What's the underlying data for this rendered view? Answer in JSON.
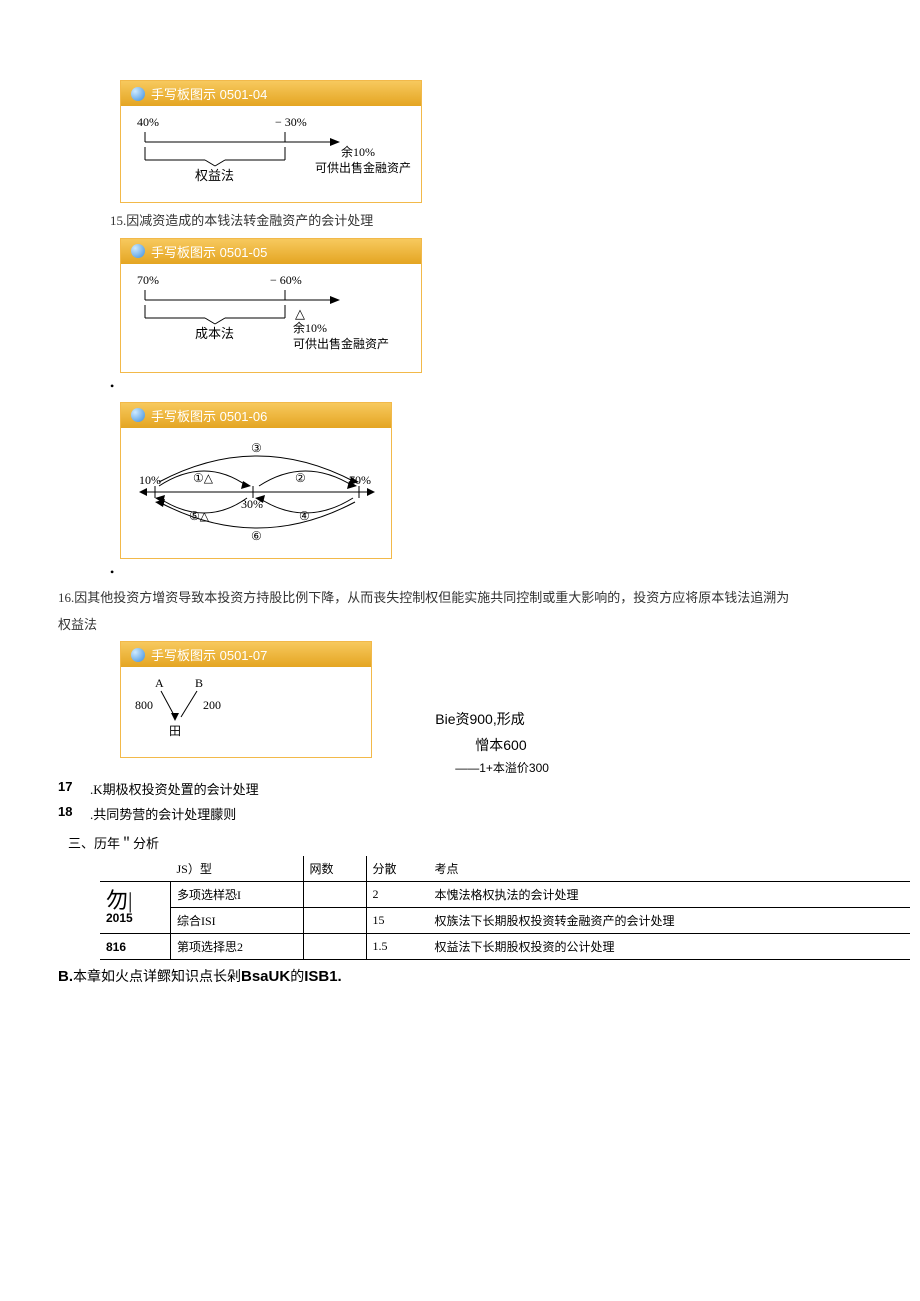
{
  "diagrams": {
    "d04": {
      "header": "手写板图示  0501-04",
      "left": "40%",
      "right": "− 30%",
      "method": "权益法",
      "rest": "余10%",
      "asset": "可供出售金融资产"
    },
    "d05": {
      "header": "手写板图示  0501-05",
      "left": "70%",
      "right": "− 60%",
      "method": "成本法",
      "rest": "余10%",
      "asset": "可供出售金融资产"
    },
    "d06": {
      "header": "手写板图示  0501-06",
      "p10": "10%",
      "p30": "30%",
      "p70": "70%",
      "c1": "①△",
      "c2": "②",
      "c3": "③",
      "c4": "④",
      "c5": "⑤△",
      "c6": "⑥"
    },
    "d07": {
      "header": "手写板图示  0501-07",
      "a": "A",
      "b": "B",
      "v800": "800",
      "v200": "200",
      "tian": "田",
      "line1": "Bie资900,形成",
      "line2": "憎本600",
      "line3": "——1+本溢价300"
    }
  },
  "paras": {
    "p15": "15.因减资造成的本钱法转金融资产的会计处理",
    "p16": "16.因其他投资方增资导致本投资方持股比例下降，从而丧失控制权但能实施共同控制或重大影响的，投资方应将原本钱法追溯为",
    "p16b": "权益法",
    "p17_n": "17",
    "p17_t": ".K期极权投资处置的会计处理",
    "p18_n": "18",
    "p18_t": ".共同势营的会计处理朦则",
    "sec3": "三、历年＂分析",
    "footer_pre": "B.",
    "footer_mid": "本章如火点详鳏知识点长剁",
    "footer_b1": "BsaUK",
    "footer_mid2": "的",
    "footer_b2": "ISB1."
  },
  "table": {
    "headers": {
      "type": "JS）型",
      "count": "网数",
      "score": "分散",
      "topic": "考点"
    },
    "left": {
      "year_glyph": "勿|",
      "year": "2015",
      "y2": "816"
    },
    "rows": [
      {
        "type": "多项选样恐I",
        "count": "",
        "score": "2",
        "topic": "本愧法格权执法的会计处理"
      },
      {
        "type": "综合ISI",
        "count": "",
        "score": "15",
        "topic": "权族法下长期股权投资转金融资产的会计处理"
      },
      {
        "type": "第项选择思2",
        "count": "",
        "score": "1.5",
        "topic": "权益法下长期股权投资的公计处理"
      }
    ]
  }
}
